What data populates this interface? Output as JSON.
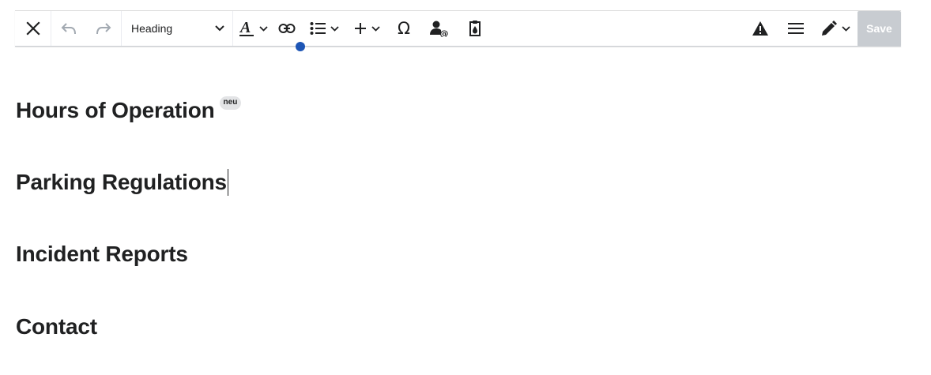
{
  "toolbar": {
    "format_label": "Heading",
    "save_label": "Save",
    "icons": {
      "close": "close-icon",
      "undo": "undo-icon",
      "redo": "redo-icon",
      "text_style": "text-style-icon",
      "link": "link-icon",
      "list": "bullet-list-icon",
      "insert": "plus-icon",
      "special_char": "omega-icon",
      "mention": "user-mention-icon",
      "cite": "cite-clipboard-icon",
      "notices": "warning-icon",
      "page_options": "hamburger-menu-icon",
      "edit_mode": "pencil-icon"
    },
    "colors": {
      "save_disabled_bg": "#c8ccd1",
      "link_dot": "#1d55b5",
      "disabled_icon": "#a2a9b1"
    }
  },
  "document": {
    "headings": [
      {
        "text": "Hours of Operation",
        "badge": "neu"
      },
      {
        "text": "Parking Regulations"
      },
      {
        "text": "Incident Reports"
      },
      {
        "text": "Contact"
      }
    ]
  }
}
